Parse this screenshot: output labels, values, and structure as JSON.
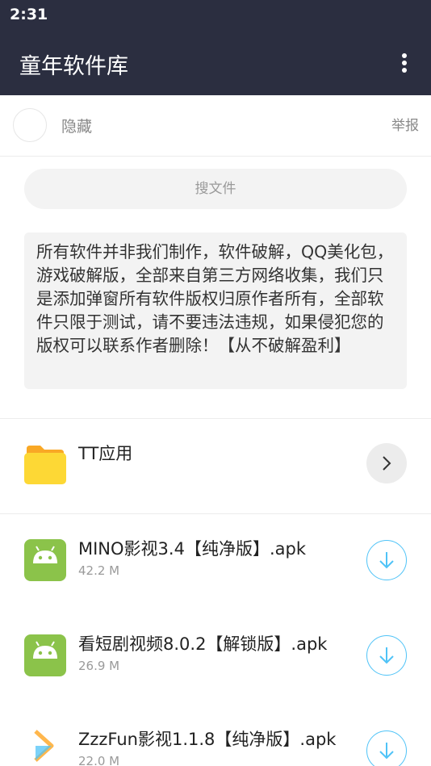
{
  "status_bar": {
    "time": "2:31"
  },
  "app_bar": {
    "title": "童年软件库"
  },
  "user": {
    "name": "隐藏",
    "report_label": "举报"
  },
  "search": {
    "placeholder": "搜文件"
  },
  "notice": {
    "text": "所有软件并非我们制作，软件破解，QQ美化包，游戏破解版，全部来自第三方网络收集，我们只是添加弹窗所有软件版权归原作者所有，全部软件只限于测试，请不要违法违规，如果侵犯您的版权可以联系作者删除！【从不破解盈利】"
  },
  "folder": {
    "name": "TT应用",
    "icon": "folder-icon"
  },
  "files": [
    {
      "name": "MINO影视3.4【纯净版】.apk",
      "size": "42.2 M",
      "icon": "android-icon"
    },
    {
      "name": "看短剧视频8.0.2【解锁版】.apk",
      "size": "26.9 M",
      "icon": "android-icon"
    },
    {
      "name": "ZzzFun影视1.1.8【纯净版】.apk",
      "size": "22.0 M",
      "icon": "app-icon"
    }
  ],
  "colors": {
    "app_bar": "#2b2e40",
    "accent": "#4fc3f7",
    "android_green": "#8bc34a",
    "folder_yellow": "#fdd835"
  }
}
